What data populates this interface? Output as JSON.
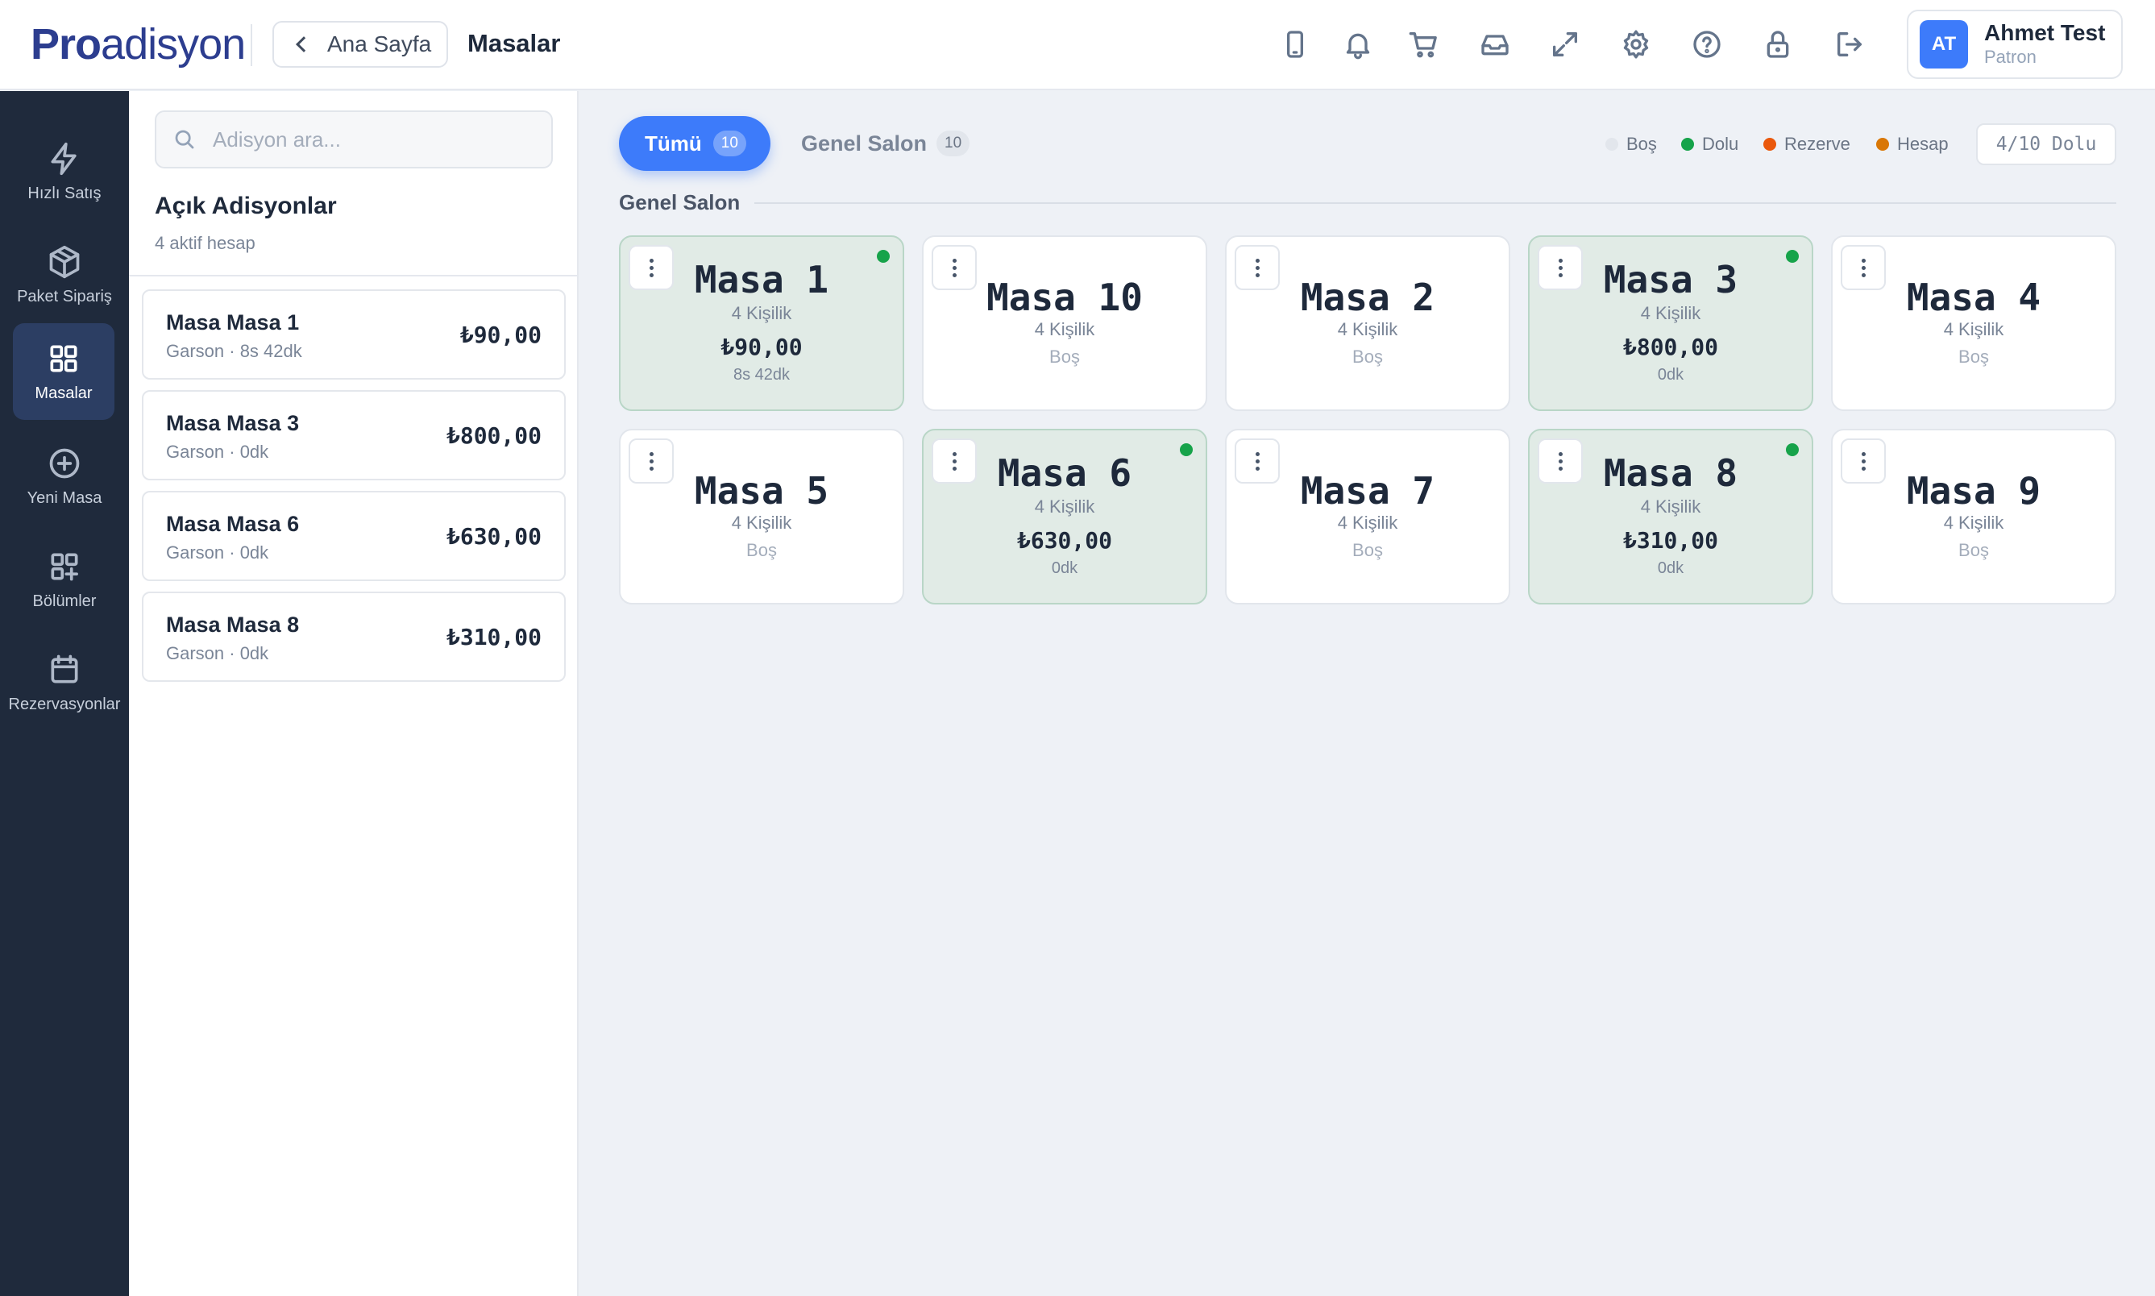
{
  "header": {
    "logo_bold": "Pro",
    "logo_rest": "adisyon",
    "back_label": "Ana Sayfa",
    "page_title": "Masalar",
    "icons": [
      "tablet-icon",
      "bell-icon",
      "cart-icon",
      "inbox-icon",
      "expand-icon",
      "gear-icon",
      "help-icon",
      "lock-icon",
      "logout-icon"
    ],
    "user": {
      "initials": "AT",
      "name": "Ahmet Test",
      "role": "Patron",
      "avatar_color": "#3d7bfa"
    }
  },
  "sidebar": {
    "items": [
      {
        "label": "Hızlı Satış",
        "icon": "lightning-icon",
        "active": false
      },
      {
        "label": "Paket Sipariş",
        "icon": "package-icon",
        "active": false
      },
      {
        "label": "Masalar",
        "icon": "grid-icon",
        "active": true
      },
      {
        "label": "Yeni Masa",
        "icon": "plus-circle-icon",
        "active": false
      },
      {
        "label": "Bölümler",
        "icon": "grid-plus-icon",
        "active": false
      },
      {
        "label": "Rezervasyonlar",
        "icon": "calendar-icon",
        "active": false
      }
    ]
  },
  "panel": {
    "search_placeholder": "Adisyon ara...",
    "title": "Açık Adisyonlar",
    "subtitle": "4 aktif hesap",
    "bills": [
      {
        "name": "Masa Masa 1",
        "meta": "Garson · 8s 42dk",
        "amount": "₺90,00"
      },
      {
        "name": "Masa Masa 3",
        "meta": "Garson · 0dk",
        "amount": "₺800,00"
      },
      {
        "name": "Masa Masa 6",
        "meta": "Garson · 0dk",
        "amount": "₺630,00"
      },
      {
        "name": "Masa Masa 8",
        "meta": "Garson · 0dk",
        "amount": "₺310,00"
      }
    ]
  },
  "main": {
    "tabs": [
      {
        "label": "Tümü",
        "count": "10",
        "active": true
      },
      {
        "label": "Genel Salon",
        "count": "10",
        "active": false
      }
    ],
    "legend": [
      {
        "label": "Boş",
        "color": "#e2e6ec"
      },
      {
        "label": "Dolu",
        "color": "#16a34a"
      },
      {
        "label": "Rezerve",
        "color": "#ea580c"
      },
      {
        "label": "Hesap",
        "color": "#d97706"
      }
    ],
    "occupancy": "4/10 Dolu",
    "section_title": "Genel Salon",
    "tables": [
      {
        "name": "Masa 1",
        "capacity": "4 Kişilik",
        "busy": true,
        "amount": "₺90,00",
        "time": "8s 42dk"
      },
      {
        "name": "Masa 10",
        "capacity": "4 Kişilik",
        "busy": false,
        "status": "Boş"
      },
      {
        "name": "Masa 2",
        "capacity": "4 Kişilik",
        "busy": false,
        "status": "Boş"
      },
      {
        "name": "Masa 3",
        "capacity": "4 Kişilik",
        "busy": true,
        "amount": "₺800,00",
        "time": "0dk"
      },
      {
        "name": "Masa 4",
        "capacity": "4 Kişilik",
        "busy": false,
        "status": "Boş"
      },
      {
        "name": "Masa 5",
        "capacity": "4 Kişilik",
        "busy": false,
        "status": "Boş"
      },
      {
        "name": "Masa 6",
        "capacity": "4 Kişilik",
        "busy": true,
        "amount": "₺630,00",
        "time": "0dk"
      },
      {
        "name": "Masa 7",
        "capacity": "4 Kişilik",
        "busy": false,
        "status": "Boş"
      },
      {
        "name": "Masa 8",
        "capacity": "4 Kişilik",
        "busy": true,
        "amount": "₺310,00",
        "time": "0dk"
      },
      {
        "name": "Masa 9",
        "capacity": "4 Kişilik",
        "busy": false,
        "status": "Boş"
      }
    ]
  }
}
